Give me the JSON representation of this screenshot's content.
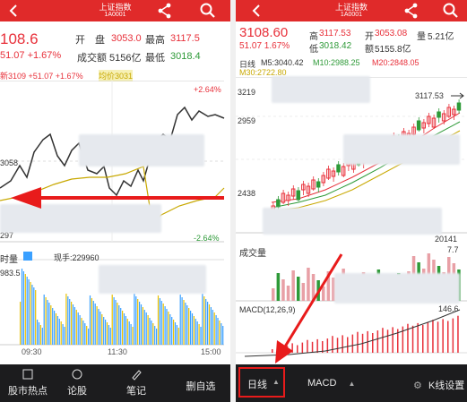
{
  "left": {
    "index_title": "上证指数",
    "index_code": "1A0001",
    "price": "108.6",
    "change": "51.07 +1.67%",
    "open_label": "开　盘",
    "open_value": "3053.0",
    "high_label": "最高",
    "high_value": "3117.5",
    "turnover_label": "成交额",
    "turnover_value": "5156亿",
    "low_label": "最低",
    "low_value": "3018.4",
    "legend_text": "新3109 +51.07 +1.67%",
    "legend_avg": "均价3031",
    "pct_top": "+2.64%",
    "pct_bottom": "-2.64%",
    "price_label_mid": "3058",
    "price_label_bottom": "297",
    "volume_label": "时量",
    "volume_current": "现手:229960",
    "volume_axis_top": "983.5",
    "time_labels": [
      "09:30",
      "11:30",
      "15:00"
    ],
    "bottom_nav": [
      "股市热点",
      "论股",
      "笔记",
      "删自选"
    ]
  },
  "right": {
    "index_title": "上证指数",
    "index_code": "1A0001",
    "price": "3108.60",
    "change": "51.07 1.67%",
    "high_label": "高",
    "high_value": "3117.53",
    "open_label": "开",
    "open_value": "3053.08",
    "volume_label": "量",
    "volume_value": "5.21亿",
    "low_label": "低",
    "low_value": "3018.42",
    "amount_label": "额",
    "amount_value": "5155.8亿",
    "period_label": "日线",
    "ma5": "M5:3040.42",
    "ma10": "M10:2988.25",
    "ma20": "M20:2848.05",
    "ma30": "M30:2722.80",
    "axis_labels": [
      "3219",
      "2959",
      "2438"
    ],
    "high_marker": "3117.53",
    "date_label": "20141",
    "volume_section_label": "成交量",
    "volume_axis_value": "7.7",
    "macd_label": "MACD(12,26,9)",
    "macd_axis_value": "146.6",
    "bottom_tabs": [
      "日线",
      "MACD",
      "K线设置"
    ]
  },
  "colors": {
    "header_red": "#e02a2a",
    "up_red": "#e8303a",
    "down_green": "#2e9a38",
    "avg_yellow": "#c8a800",
    "annotation_red": "#e81b1b",
    "nav_dark": "#1c1c1e",
    "axis_gray": "#333333"
  }
}
